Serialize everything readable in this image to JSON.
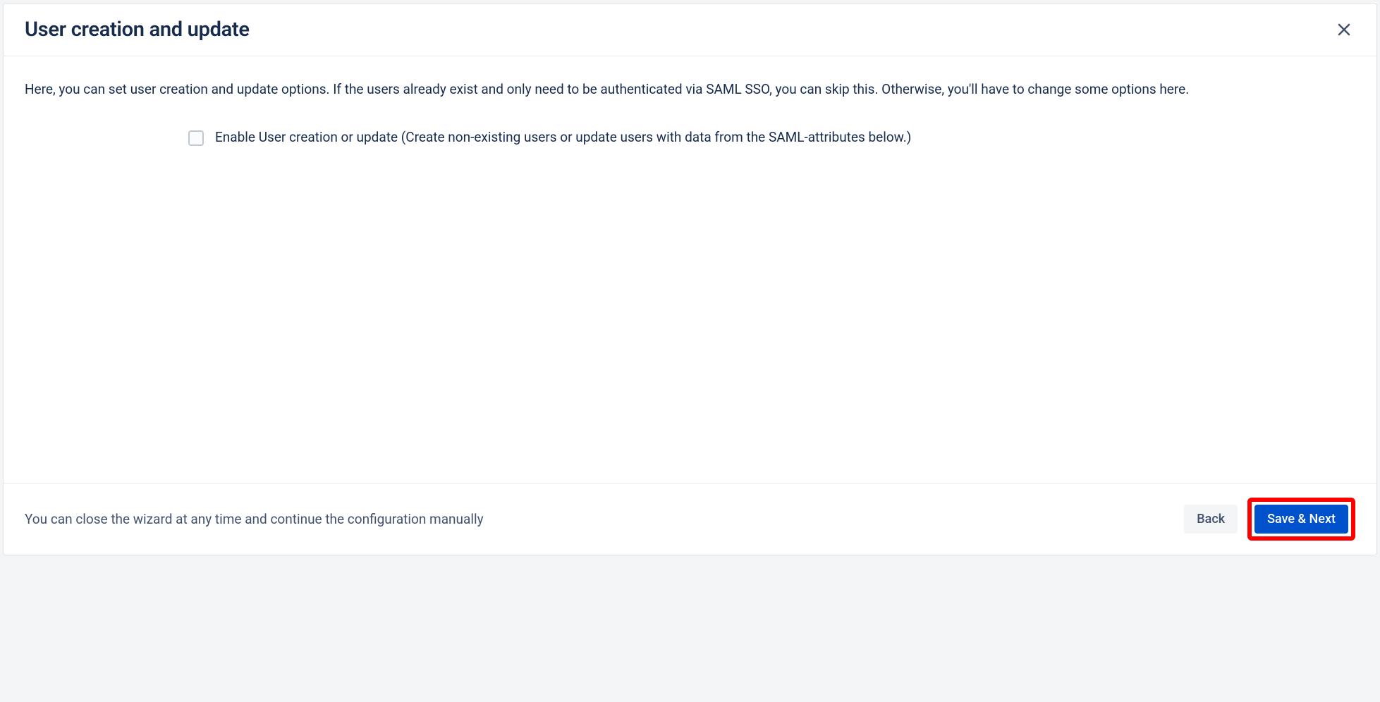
{
  "dialog": {
    "title": "User creation and update",
    "intro": "Here, you can set user creation and update options. If the users already exist and only need to be authenticated via SAML SSO, you can skip this. Otherwise, you'll have to change some options here.",
    "checkbox": {
      "label": "Enable User creation or update (Create non-existing users or update users with data from the SAML-attributes below.)",
      "checked": false
    },
    "footer": {
      "hint": "You can close the wizard at any time and continue the configuration manually",
      "back_label": "Back",
      "save_next_label": "Save & Next"
    }
  }
}
